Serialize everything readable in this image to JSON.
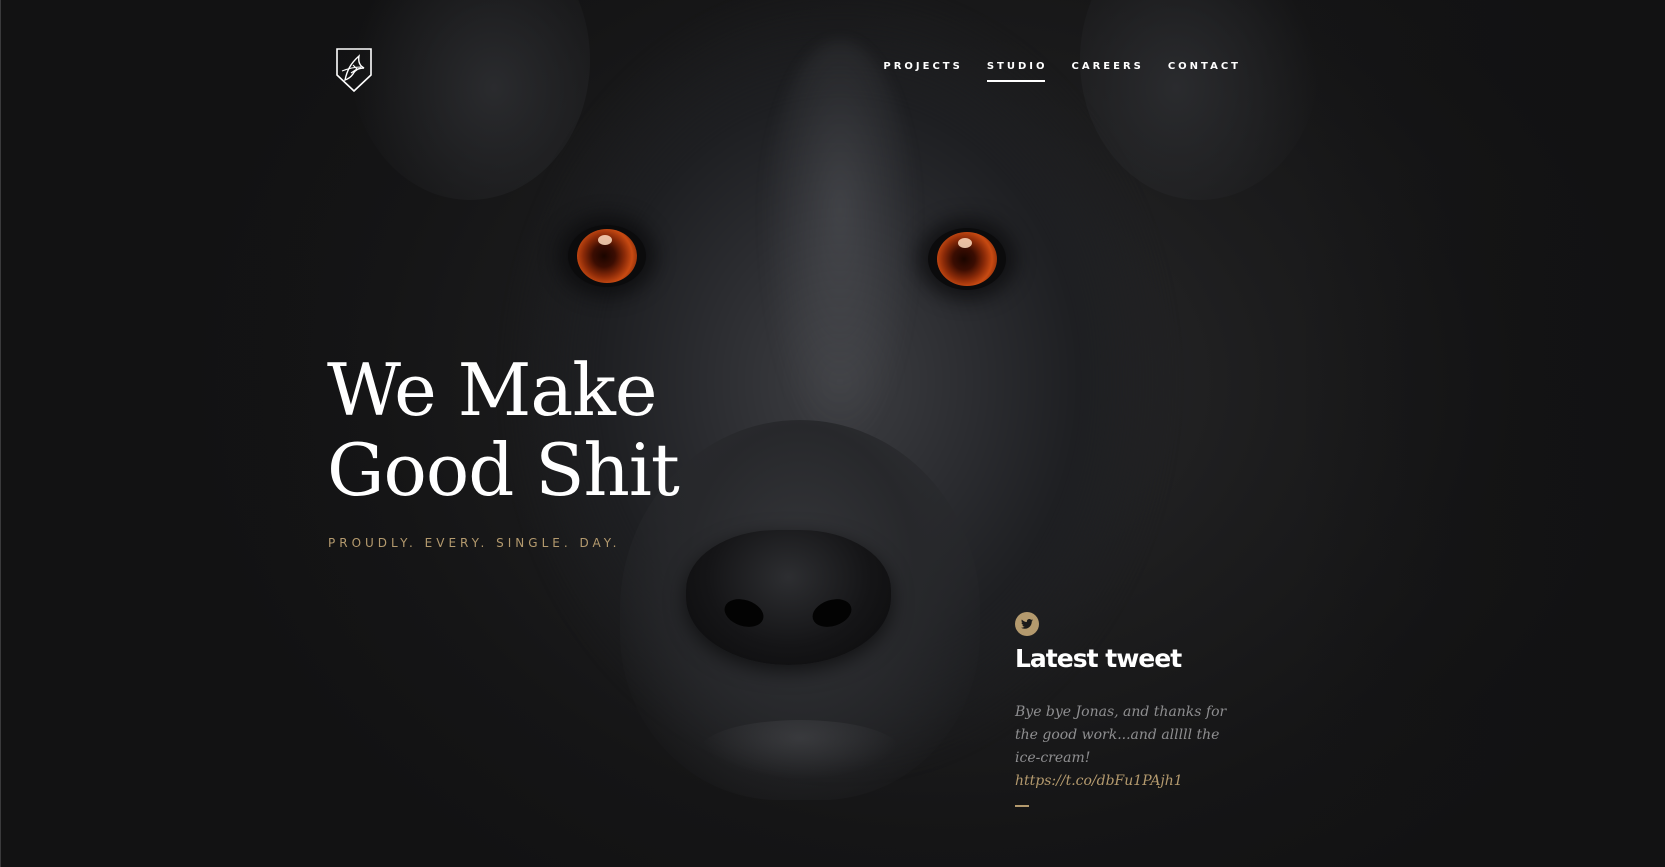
{
  "header": {
    "logo_icon": "fox-shield-logo-icon",
    "nav": [
      {
        "label": "PROJECTS",
        "active": false
      },
      {
        "label": "STUDIO",
        "active": true
      },
      {
        "label": "CAREERS",
        "active": false
      },
      {
        "label": "CONTACT",
        "active": false
      }
    ]
  },
  "hero": {
    "title_line1": "We Make",
    "title_line2": "Good Shit",
    "tagline": "PROUDLY. EVERY. SINGLE. DAY.",
    "background_image": "black-dog-portrait"
  },
  "tweet": {
    "icon": "twitter-icon",
    "heading": "Latest tweet",
    "text": "Bye bye Jonas, and thanks for the good work...and alllll the ice-cream!",
    "link": "https://t.co/dbFu1PAjh1"
  },
  "colors": {
    "accent": "#b49a6e",
    "text_primary": "#ffffff",
    "text_muted": "#8e8e90",
    "background": "#151515"
  }
}
